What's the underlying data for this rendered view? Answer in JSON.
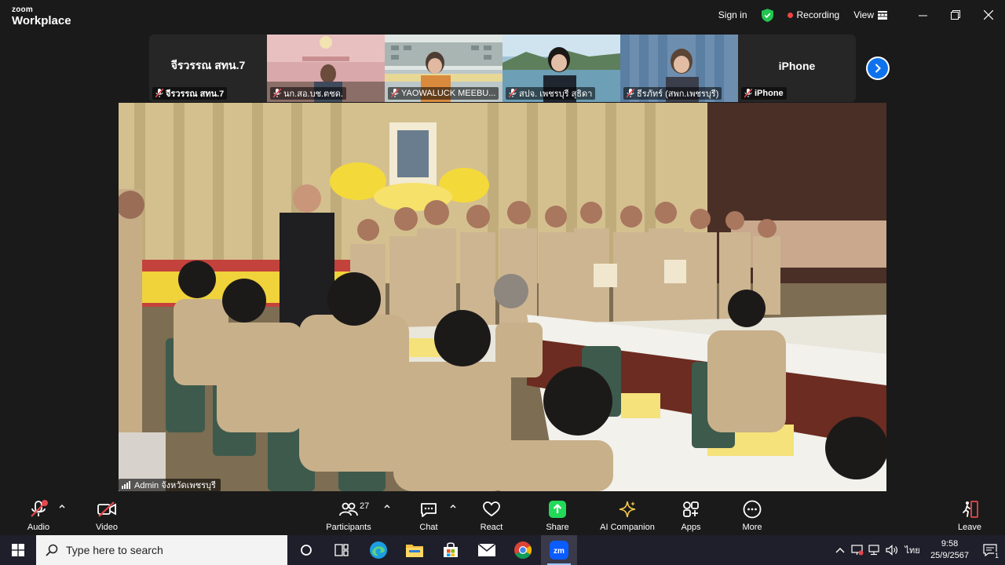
{
  "app": {
    "brand_top": "zoom",
    "brand_bottom": "Workplace"
  },
  "titlebar": {
    "sign_in": "Sign in",
    "recording": "Recording",
    "view": "View"
  },
  "thumbnails": [
    {
      "big_name": "จีรวรรณ สทน.7",
      "name": "จีรวรรณ สทน.7"
    },
    {
      "name": "นก.สอ.บช.ตชด."
    },
    {
      "name": "YAOWALUCK MEEBU..."
    },
    {
      "name": "สปจ. เพชรบุรี สุธิดา"
    },
    {
      "name": "ธีรภัทร์ (สพก.เพชรบุรี)"
    },
    {
      "big_name": "iPhone",
      "name": "iPhone"
    }
  ],
  "main_video": {
    "name": "Admin จังหวัดเพชรบุรี"
  },
  "toolbar": {
    "audio": "Audio",
    "video": "Video",
    "participants": "Participants",
    "participants_count": "27",
    "chat": "Chat",
    "react": "React",
    "share": "Share",
    "ai_companion": "AI Companion",
    "apps": "Apps",
    "more": "More",
    "leave": "Leave"
  },
  "taskbar": {
    "search_placeholder": "Type here to search",
    "lang": "ไทย",
    "time": "9:58",
    "date": "25/9/2567",
    "notifications": "1"
  },
  "colors": {
    "accent": "#0e72ed",
    "share_green": "#23d959",
    "recording_red": "#ef4444",
    "leave_red": "#e5484d"
  }
}
